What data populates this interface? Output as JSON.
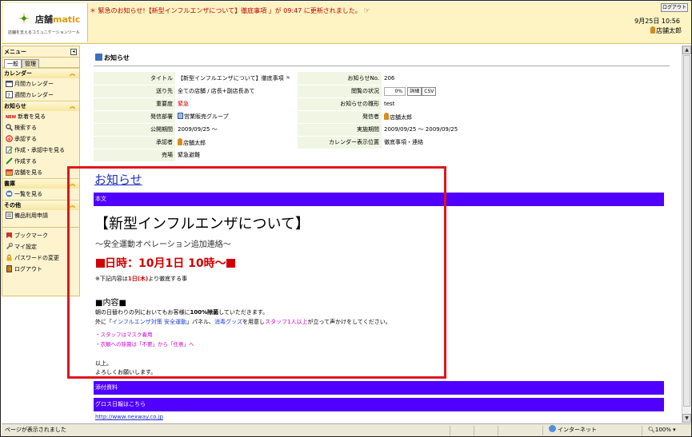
{
  "header": {
    "logo_name_prefix": "店舗",
    "logo_name_suffix": "matic",
    "logo_tagline": "店舗を支えるコミュニケーションツール",
    "alert_star": "＊",
    "alert_text": "緊急のお知らせ!【新型インフルエンザについて】徹底事項 」が 09:47 に更新されました。",
    "logout_label": "ログアウト",
    "datetime": "9月25日 10:56",
    "user_name": "店舗太郎"
  },
  "sidebar": {
    "menu_label": "メニュー",
    "tabs": [
      "一般",
      "管理"
    ],
    "sections": [
      {
        "title": "カレンダー",
        "items": [
          "月間カレンダー",
          "週間カレンダー"
        ]
      },
      {
        "title": "お知らせ",
        "items": [
          "新着を見る",
          "検索する",
          "承認する",
          "作成・承認中を見る",
          "作成する",
          "店舗を見る"
        ]
      },
      {
        "title": "書庫",
        "items": [
          "一覧を見る"
        ]
      },
      {
        "title": "その他",
        "items": [
          "備品利用申請"
        ]
      }
    ],
    "bottom_items": [
      "ブックマーク",
      "マイ設定",
      "パスワードの変更",
      "ログアウト"
    ],
    "new_badge": "NEW"
  },
  "page": {
    "title": "お知らせ"
  },
  "detail": {
    "rows": [
      {
        "l1": "タイトル",
        "v1": "【新型インフルエンザについて】徹底事項",
        "l2": "お知らせNo.",
        "v2": "206"
      },
      {
        "l1": "送り先",
        "v1": "全ての店舗 / 店長+副店長あて",
        "l2": "閲覧の状況",
        "v2": "0%"
      },
      {
        "l1": "重要度",
        "v1": "緊急",
        "l2": "お知らせの雛形",
        "v2": "test"
      },
      {
        "l1": "発信部署",
        "v1": "営業販売グループ",
        "l2": "発信者",
        "v2": "店舗太郎"
      },
      {
        "l1": "公開期間",
        "v1": "2009/09/25 ～",
        "l2": "実施期間",
        "v2": "2009/09/25 ～ 2009/09/25"
      },
      {
        "l1": "承認者",
        "v1": "店舗太郎",
        "l2": "カレンダー表示位置",
        "v2": "徹底事項・連絡"
      },
      {
        "l1": "売場",
        "v1": "緊急避難",
        "l2": "",
        "v2": ""
      }
    ],
    "detail_button": "詳細",
    "csv_button": "CSV"
  },
  "notice": {
    "link_title": "お知らせ",
    "body_bar": "本文",
    "headline": "【新型インフルエンザについて】",
    "subline": "～安全運動オペレーション追加連絡～",
    "date_text": "日時：10月1日 10時～",
    "note_prefix": "※下記内容は",
    "note_bold": "1日(木)",
    "note_suffix": "より徹底する事",
    "section_head": "■内容■",
    "line1_a": "朝の日替わりの列においてもお客様に",
    "line1_b": "100%除菌",
    "line1_c": "していただきます。",
    "line2_a": "外に「",
    "line2_b": "インフルエンザ対策 安全運動",
    "line2_c": "」パネル、",
    "line2_d": "消毒グッズ",
    "line2_e": "を用意し",
    "line2_f": "スタッフ1人以上",
    "line2_g": "が立って声かけをしてください。",
    "pink1": "・スタッフはマスク着用",
    "pink2": "・衣類への除菌は「不要」から「任意」へ",
    "closing1": "以上。",
    "closing2": "よろしくお願いします。",
    "attach_bar": "添付資料",
    "group_bar": "グロス日報はこちら",
    "url": "http://www.nexway.co.jp"
  },
  "status": {
    "left_text": "ページが表示されました",
    "zone": "インターネット",
    "zoom": "100%"
  },
  "colors": {
    "header_bg": "#fdf3c3",
    "bar_purple": "#5000ff",
    "alert_red": "#c00000",
    "highlight_red": "#e0161c"
  }
}
